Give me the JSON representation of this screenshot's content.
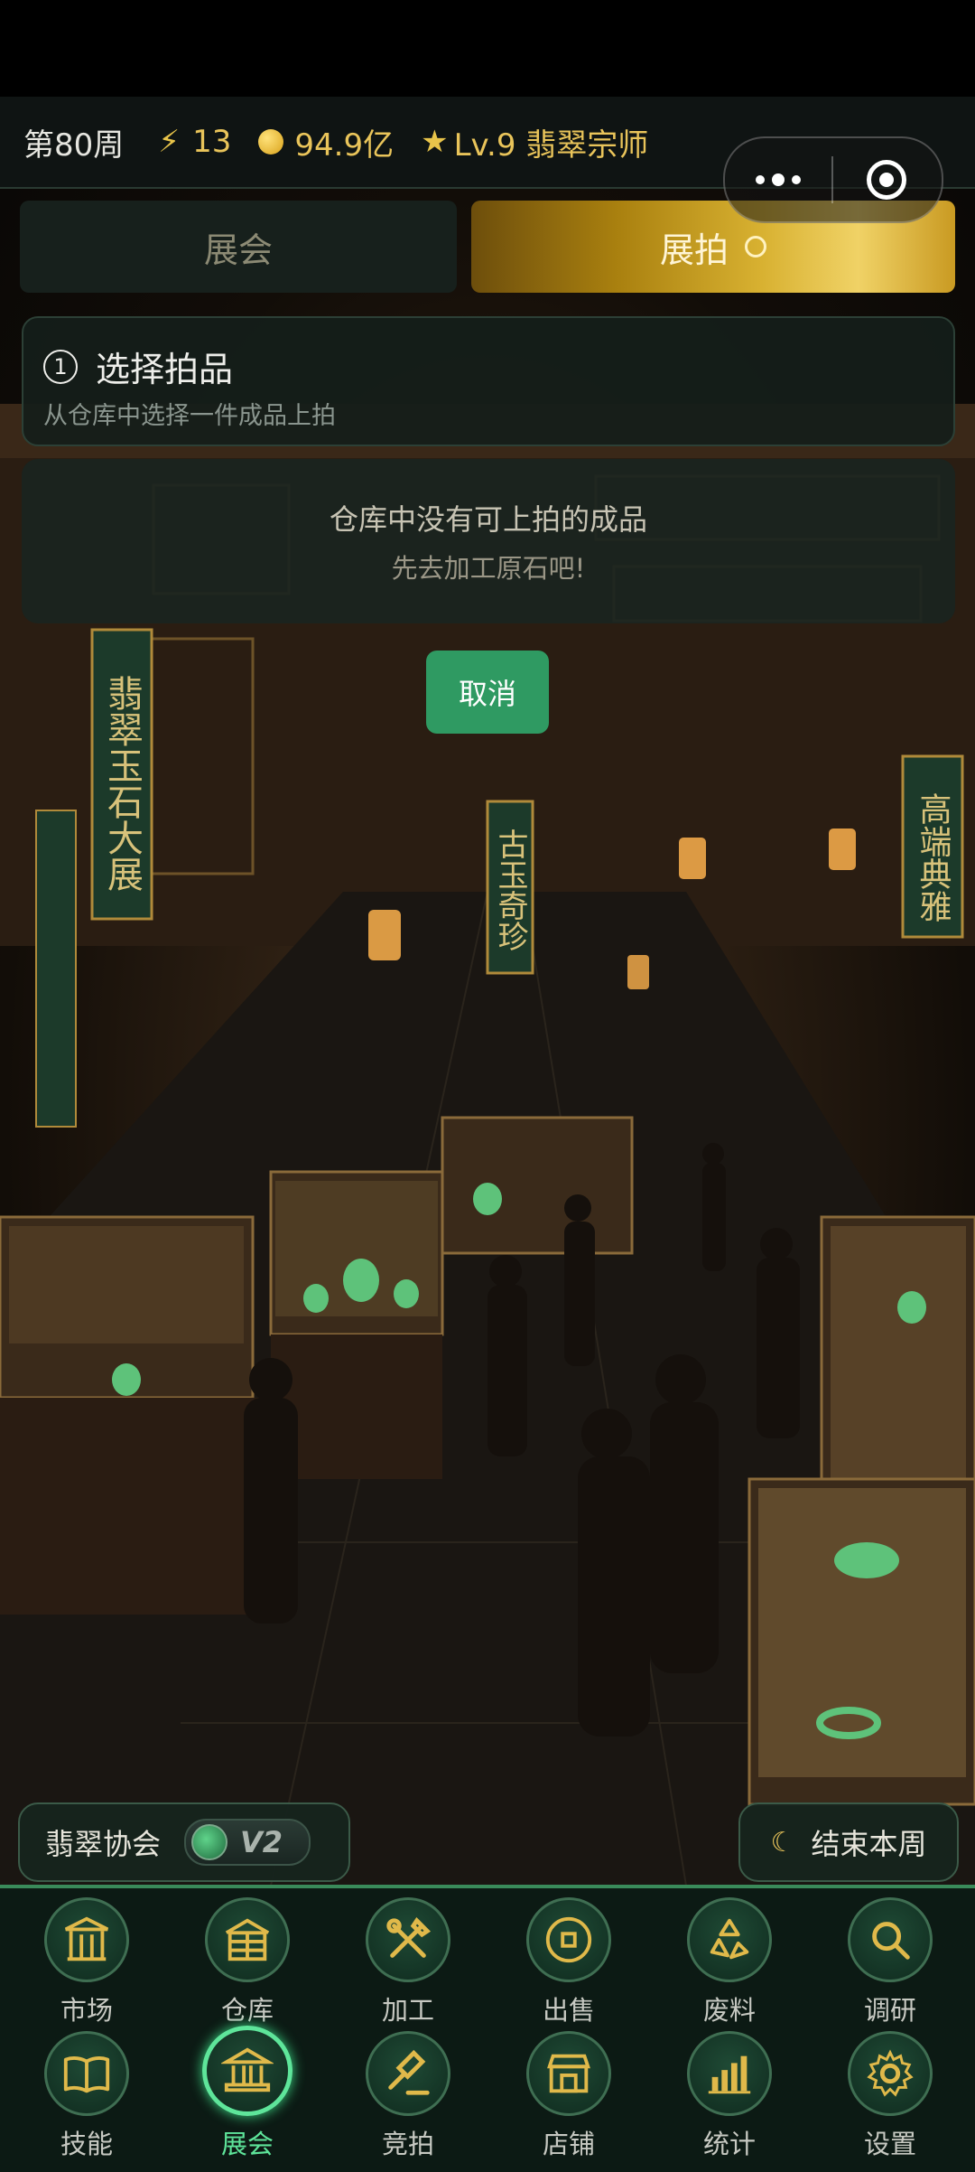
{
  "status_bar": {
    "week": "第80周",
    "energy": "13",
    "coins": "94.9亿",
    "level": "Lv.9 翡翠宗师"
  },
  "tabs": {
    "expo": "展会",
    "auction": "展拍"
  },
  "step": {
    "number": "1",
    "title": "选择拍品",
    "subtitle": "从仓库中选择一件成品上拍"
  },
  "empty_state": {
    "message": "仓库中没有可上拍的成品",
    "hint": "先去加工原石吧!"
  },
  "cancel_label": "取消",
  "association": {
    "label": "翡翠协会",
    "badge": "V2"
  },
  "end_week_label": "结束本周",
  "nav": [
    {
      "label": "市场",
      "icon": "gate-icon",
      "active": false
    },
    {
      "label": "仓库",
      "icon": "warehouse-icon",
      "active": false
    },
    {
      "label": "加工",
      "icon": "tools-icon",
      "active": false
    },
    {
      "label": "出售",
      "icon": "coin-icon",
      "active": false
    },
    {
      "label": "废料",
      "icon": "recycle-icon",
      "active": false
    },
    {
      "label": "调研",
      "icon": "magnifier-icon",
      "active": false
    },
    {
      "label": "技能",
      "icon": "book-icon",
      "active": false
    },
    {
      "label": "展会",
      "icon": "museum-icon",
      "active": true
    },
    {
      "label": "竞拍",
      "icon": "gavel-icon",
      "active": false
    },
    {
      "label": "店铺",
      "icon": "shop-icon",
      "active": false
    },
    {
      "label": "统计",
      "icon": "bar-chart-icon",
      "active": false
    },
    {
      "label": "设置",
      "icon": "gear-icon",
      "active": false
    }
  ],
  "scene": {
    "banners": [
      "翡翠玉石大展",
      "古玉奇珍",
      "高端典雅",
      "翡翠玉石大展"
    ]
  }
}
